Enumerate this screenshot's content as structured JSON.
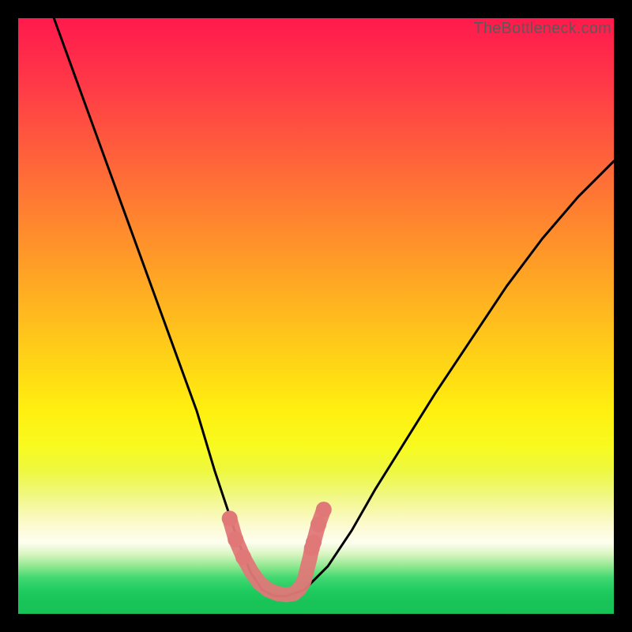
{
  "watermark": "TheBottleneck.com",
  "chart_data": {
    "type": "line",
    "title": "",
    "xlabel": "",
    "ylabel": "",
    "xlim": [
      0,
      100
    ],
    "ylim": [
      0,
      100
    ],
    "grid": false,
    "legend": false,
    "series": [
      {
        "name": "bottleneck-curve",
        "type": "line",
        "color": "#000000",
        "x": [
          6,
          10,
          14,
          18,
          22,
          26,
          30,
          33,
          35,
          37,
          39,
          41,
          43,
          45,
          48,
          52,
          56,
          60,
          65,
          70,
          76,
          82,
          88,
          94,
          100
        ],
        "y": [
          100,
          89,
          78,
          67,
          56,
          45,
          34,
          24,
          18,
          12,
          7,
          4,
          3,
          3,
          4,
          8,
          14,
          21,
          29,
          37,
          46,
          55,
          63,
          70,
          76
        ]
      },
      {
        "name": "optimal-range-marker",
        "type": "line",
        "color": "#e07878",
        "x": [
          35.5,
          36.5,
          37.8,
          39.2,
          40.5,
          42.0,
          43.5,
          45.0,
          46.3,
          47.2,
          48.0,
          49.0,
          49.3,
          49.6,
          50.4,
          51.3
        ],
        "y": [
          16.0,
          12.5,
          9.5,
          7.0,
          5.2,
          4.0,
          3.4,
          3.2,
          3.4,
          4.2,
          5.5,
          9.5,
          11.0,
          12.0,
          15.0,
          17.5
        ]
      }
    ],
    "background": {
      "type": "vertical-gradient",
      "stops": [
        {
          "pos": 0.0,
          "color": "#ff1a4d"
        },
        {
          "pos": 0.5,
          "color": "#ffb420"
        },
        {
          "pos": 0.72,
          "color": "#f8fa20"
        },
        {
          "pos": 0.88,
          "color": "#fefef0"
        },
        {
          "pos": 1.0,
          "color": "#17c157"
        }
      ]
    }
  }
}
